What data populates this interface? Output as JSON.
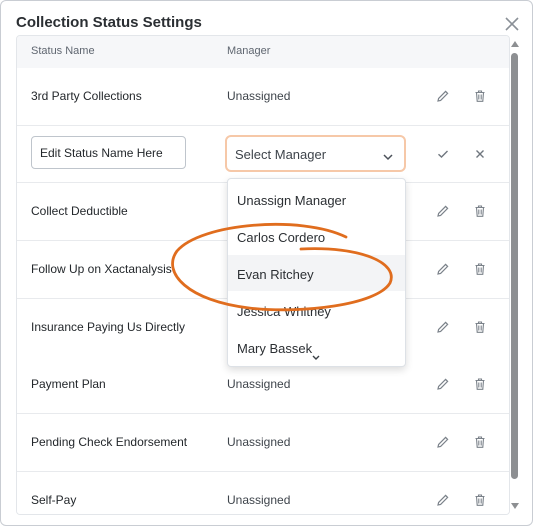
{
  "dialog": {
    "title": "Collection Status Settings"
  },
  "table": {
    "columns": [
      "Status Name",
      "Manager"
    ],
    "rows": [
      {
        "name": "3rd Party Collections",
        "manager": "Unassigned"
      },
      {
        "name": "Collect Deductible",
        "manager": ""
      },
      {
        "name": "Follow Up on Xactanalysis",
        "manager": ""
      },
      {
        "name": "Insurance Paying Us Directly",
        "manager": ""
      },
      {
        "name": "Payment Plan",
        "manager": "Unassigned"
      },
      {
        "name": "Pending Check Endorsement",
        "manager": "Unassigned"
      },
      {
        "name": "Self-Pay",
        "manager": "Unassigned"
      }
    ]
  },
  "edit_row": {
    "name_value": "Edit Status Name Here",
    "select_label": "Select Manager"
  },
  "dropdown": {
    "options": [
      "Unassign Manager",
      "Carlos Cordero",
      "Evan Ritchey",
      "Jessica Whitney",
      "Mary Bassek"
    ],
    "highlighted": "Evan Ritchey"
  },
  "colors": {
    "accent_focus": "#f6c8a8",
    "annotation": "#e06d1e"
  },
  "icons": [
    "close-icon",
    "pencil-icon",
    "trash-icon",
    "check-icon",
    "x-icon",
    "chevron-down-icon"
  ]
}
